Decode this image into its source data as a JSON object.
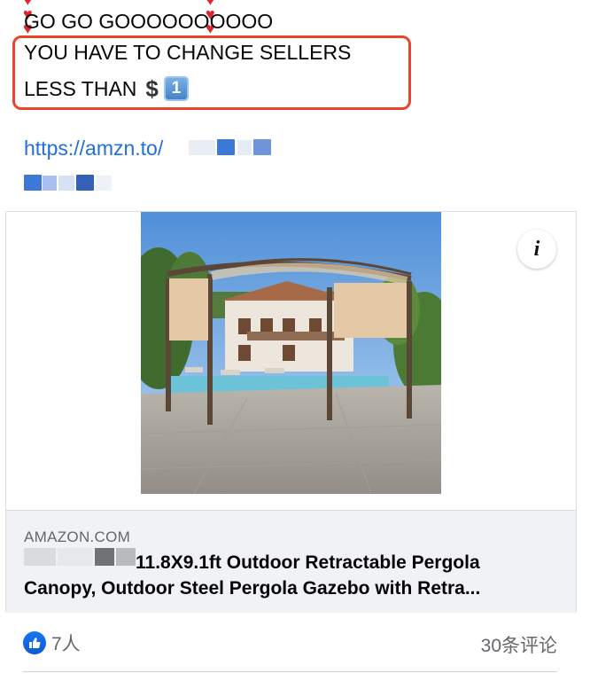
{
  "post": {
    "line1": "GO GO GOOOOOOOOOO",
    "line2": "YOU HAVE TO CHANGE SELLERS",
    "line3": "LESS THAN",
    "dollar_symbol": "$",
    "keycap_number": "1",
    "link_text": "https://amzn.to/"
  },
  "card": {
    "info_label": "i",
    "domain": "AMAZON.COM",
    "title_line1": "11.8X9.1ft Outdoor Retractable Pergola",
    "title_line2": "Canopy, Outdoor Steel Pergola Gazebo with Retra..."
  },
  "footer": {
    "reaction_count": "7人",
    "comment_count": "30条评论"
  },
  "colors": {
    "highlight_border": "#e8452a",
    "link": "#216fdb",
    "like_blue": "#1877f2"
  },
  "icons": [
    "heart-emoji-icon",
    "heavy-dollar-sign-icon",
    "keycap-one-icon",
    "info-icon",
    "like-icon"
  ]
}
